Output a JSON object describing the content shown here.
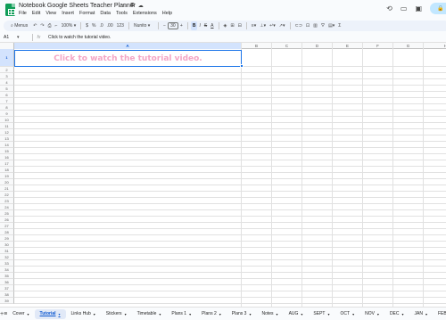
{
  "doc": {
    "title": "Notebook Google Sheets Teacher Planner",
    "title_icons": [
      "star-icon",
      "move-to-folder-icon",
      "cloud-status-icon"
    ]
  },
  "menu": [
    "File",
    "Edit",
    "View",
    "Insert",
    "Format",
    "Data",
    "Tools",
    "Extensions",
    "Help"
  ],
  "toolbar": {
    "menus_label": "Menus",
    "zoom": "100%",
    "currency": "$",
    "percent": "%",
    "decrease_decimal": ".0",
    "increase_decimal": ".00",
    "number_format": "123",
    "font": "Nunito",
    "font_size": "30",
    "bold": "B",
    "italic": "I",
    "strike": "S",
    "text_color": "A"
  },
  "formula_bar": {
    "name_box": "A1",
    "fx": "fx",
    "content": "Click to watch the tutorial video."
  },
  "grid": {
    "columns": [
      "A",
      "B",
      "C",
      "D",
      "E",
      "F",
      "G",
      "H"
    ],
    "selected_column": "A",
    "row_numbers": [
      "1",
      "2",
      "3",
      "4",
      "5",
      "6",
      "7",
      "8",
      "9",
      "10",
      "11",
      "12",
      "13",
      "14",
      "15",
      "16",
      "17",
      "18",
      "19",
      "20",
      "21",
      "22",
      "23",
      "24",
      "25",
      "26",
      "27",
      "28",
      "29",
      "30",
      "31",
      "32",
      "33",
      "34",
      "35",
      "36",
      "37",
      "38",
      "39"
    ],
    "selected_row": "1",
    "a1_text": "Click to watch the tutorial video.",
    "a1_color": "#f4a6c6",
    "selection_color": "#1a73e8"
  },
  "tabs": {
    "add": "+",
    "all_sheets": "≡",
    "items": [
      "Cover",
      "Tutorial",
      "Links Hub",
      "Stickers",
      "Timetable",
      "Plans 1",
      "Plans 2",
      "Plans 3",
      "Notes",
      "AUG",
      "SEPT",
      "OCT",
      "NOV",
      "DEC",
      "JAN",
      "FEB"
    ],
    "active": "Tutorial"
  }
}
